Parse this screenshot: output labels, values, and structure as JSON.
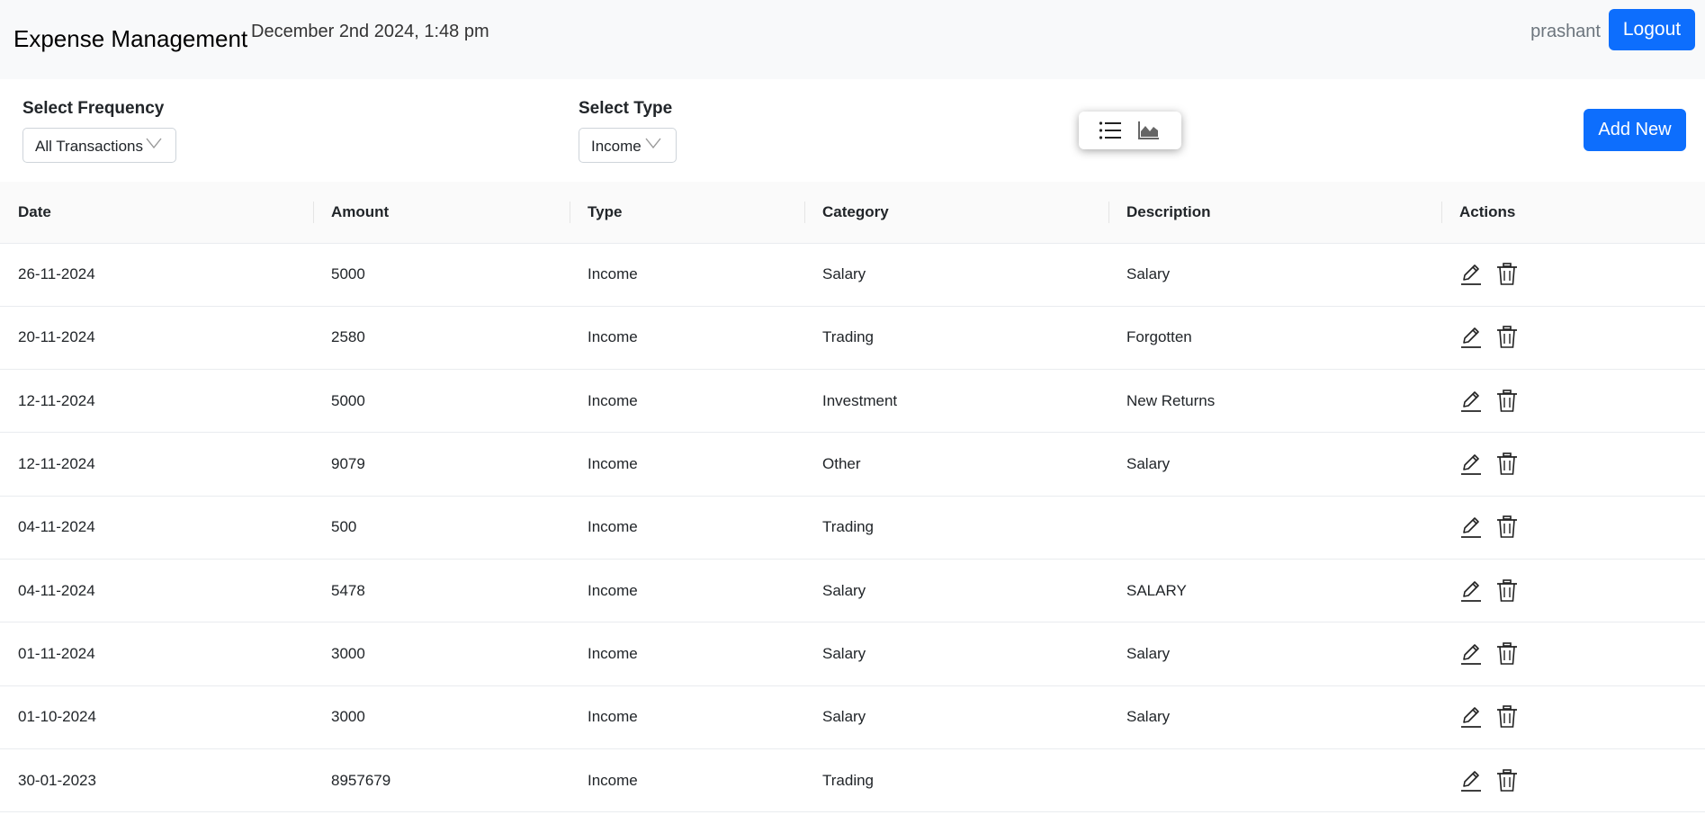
{
  "navbar": {
    "brand": "Expense Management",
    "datetime": "December 2nd 2024, 1:48 pm",
    "username": "prashant",
    "logout_label": "Logout"
  },
  "filters": {
    "frequency_label": "Select Frequency",
    "frequency_value": "All Transactions",
    "type_label": "Select Type",
    "type_value": "Income",
    "add_new_label": "Add New"
  },
  "view_toggle": {
    "list_icon": "list-icon",
    "chart_icon": "area-chart-icon"
  },
  "table": {
    "columns": [
      "Date",
      "Amount",
      "Type",
      "Category",
      "Description",
      "Actions"
    ],
    "rows": [
      {
        "date": "26-11-2024",
        "amount": "5000",
        "type": "Income",
        "category": "Salary",
        "description": "Salary"
      },
      {
        "date": "20-11-2024",
        "amount": "2580",
        "type": "Income",
        "category": "Trading",
        "description": "Forgotten"
      },
      {
        "date": "12-11-2024",
        "amount": "5000",
        "type": "Income",
        "category": "Investment",
        "description": "New Returns"
      },
      {
        "date": "12-11-2024",
        "amount": "9079",
        "type": "Income",
        "category": "Other",
        "description": "Salary"
      },
      {
        "date": "04-11-2024",
        "amount": "500",
        "type": "Income",
        "category": "Trading",
        "description": ""
      },
      {
        "date": "04-11-2024",
        "amount": "5478",
        "type": "Income",
        "category": "Salary",
        "description": "SALARY"
      },
      {
        "date": "01-11-2024",
        "amount": "3000",
        "type": "Income",
        "category": "Salary",
        "description": "Salary"
      },
      {
        "date": "01-10-2024",
        "amount": "3000",
        "type": "Income",
        "category": "Salary",
        "description": "Salary"
      },
      {
        "date": "30-01-2023",
        "amount": "8957679",
        "type": "Income",
        "category": "Trading",
        "description": ""
      }
    ]
  },
  "colors": {
    "primary": "#0d6efd",
    "navbar_bg": "#f8f9fa"
  }
}
